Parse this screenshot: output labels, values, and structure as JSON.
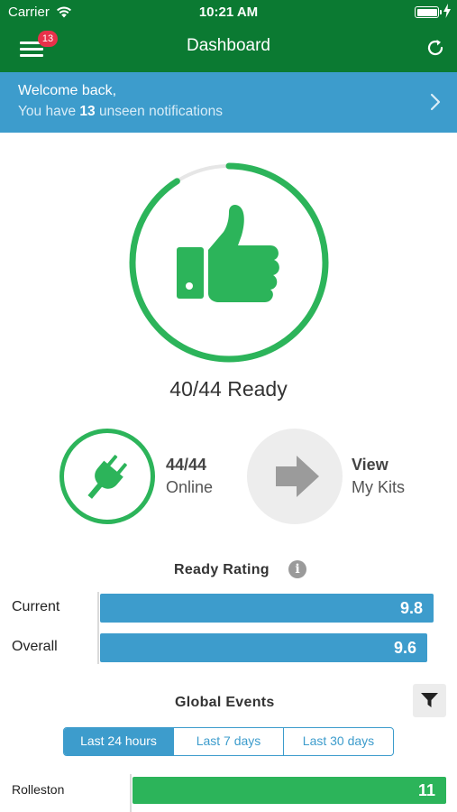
{
  "status_bar": {
    "carrier": "Carrier",
    "time": "10:21 AM"
  },
  "nav": {
    "title": "Dashboard",
    "menu_badge": "13"
  },
  "banner": {
    "line1": "Welcome back,",
    "line2_prefix": "You have ",
    "line2_count": "13",
    "line2_suffix": " unseen notifications"
  },
  "ready": {
    "label": "40/44 Ready",
    "ready_count": 40,
    "total": 44
  },
  "online": {
    "value": "44/44",
    "label": "Online"
  },
  "view_kits": {
    "line1": "View",
    "line2": "My Kits"
  },
  "ready_rating": {
    "title": "Ready Rating",
    "info_glyph": "i",
    "rows": [
      {
        "label": "Current",
        "value": "9.8",
        "fraction": 0.98
      },
      {
        "label": "Overall",
        "value": "9.6",
        "fraction": 0.96
      }
    ]
  },
  "global_events": {
    "title": "Global Events",
    "tabs": [
      {
        "label": "Last 24 hours",
        "active": true
      },
      {
        "label": "Last 7 days",
        "active": false
      },
      {
        "label": "Last 30 days",
        "active": false
      }
    ],
    "rows": [
      {
        "label": "Rolleston",
        "value": "11",
        "fraction": 1.0
      }
    ]
  },
  "colors": {
    "primary_green": "#0b7a32",
    "accent_green": "#2cb45a",
    "accent_blue": "#3d9ccc",
    "badge_red": "#e8314a"
  },
  "icons": {
    "menu": "hamburger-icon",
    "refresh": "refresh-icon",
    "chevron": "chevron-right-icon",
    "thumbs_up": "thumbs-up-icon",
    "plug": "plug-icon",
    "arrow": "arrow-right-icon",
    "info": "info-icon",
    "filter": "filter-icon"
  }
}
